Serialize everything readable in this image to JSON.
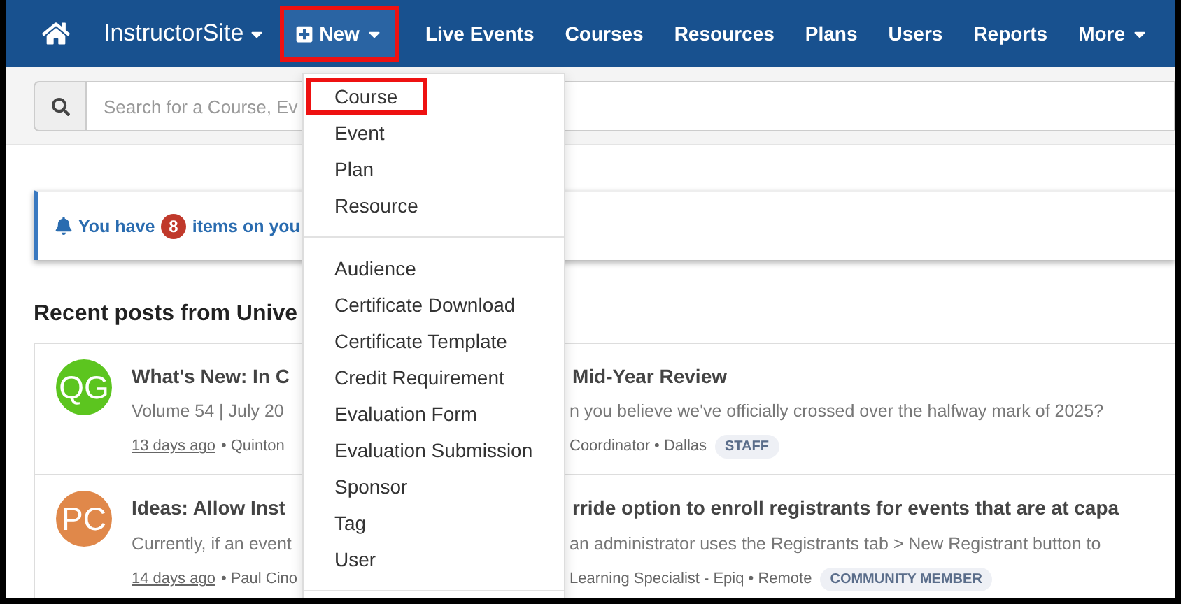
{
  "nav": {
    "brand": "InstructorSite",
    "items": [
      {
        "label": "New",
        "kind": "menu",
        "open": true,
        "annotated": true
      },
      {
        "label": "Live Events",
        "kind": "link",
        "open": false,
        "annotated": false
      },
      {
        "label": "Courses",
        "kind": "link",
        "open": false,
        "annotated": false
      },
      {
        "label": "Resources",
        "kind": "link",
        "open": false,
        "annotated": false
      },
      {
        "label": "Plans",
        "kind": "link",
        "open": false,
        "annotated": false
      },
      {
        "label": "Users",
        "kind": "link",
        "open": false,
        "annotated": false
      },
      {
        "label": "Reports",
        "kind": "link",
        "open": false,
        "annotated": false
      },
      {
        "label": "More",
        "kind": "dropdown",
        "open": false,
        "annotated": false
      }
    ]
  },
  "search": {
    "placeholder": "Search for a Course, Ev"
  },
  "alert": {
    "before": "You have",
    "count": "8",
    "after": "items on you"
  },
  "section_title": "Recent posts from Unive",
  "posts": [
    {
      "initials": "QG",
      "color": "#5cc51f",
      "title_left": "What's New: In C",
      "title_right": "Mid-Year Review",
      "text_left": "Volume 54 | July 20",
      "text_right": "n you believe we've officially crossed over the halfway mark of 2025?",
      "time": "13 days ago",
      "author_left": "• Quinton",
      "author_right": "Coordinator • Dallas",
      "tag": "STAFF"
    },
    {
      "initials": "PC",
      "color": "#e0884a",
      "title_left": "Ideas: Allow Inst",
      "title_right": "rride option to enroll registrants for events that are at capa",
      "text_left": "Currently, if an event",
      "text_right": "an administrator uses the Registrants tab > New Registrant button to",
      "time": "14 days ago",
      "author_left": "• Paul Cino",
      "author_right": "Learning Specialist - Epiq • Remote",
      "tag": "COMMUNITY MEMBER"
    }
  ],
  "new_menu": {
    "groups": [
      [
        {
          "label": "Course",
          "annotated": true
        },
        {
          "label": "Event",
          "annotated": false
        },
        {
          "label": "Plan",
          "annotated": false
        },
        {
          "label": "Resource",
          "annotated": false
        }
      ],
      [
        {
          "label": "Audience",
          "annotated": false
        },
        {
          "label": "Certificate Download",
          "annotated": false
        },
        {
          "label": "Certificate Template",
          "annotated": false
        },
        {
          "label": "Credit Requirement",
          "annotated": false
        },
        {
          "label": "Evaluation Form",
          "annotated": false
        },
        {
          "label": "Evaluation Submission",
          "annotated": false
        },
        {
          "label": "Sponsor",
          "annotated": false
        },
        {
          "label": "Tag",
          "annotated": false
        },
        {
          "label": "User",
          "annotated": false
        }
      ]
    ]
  }
}
